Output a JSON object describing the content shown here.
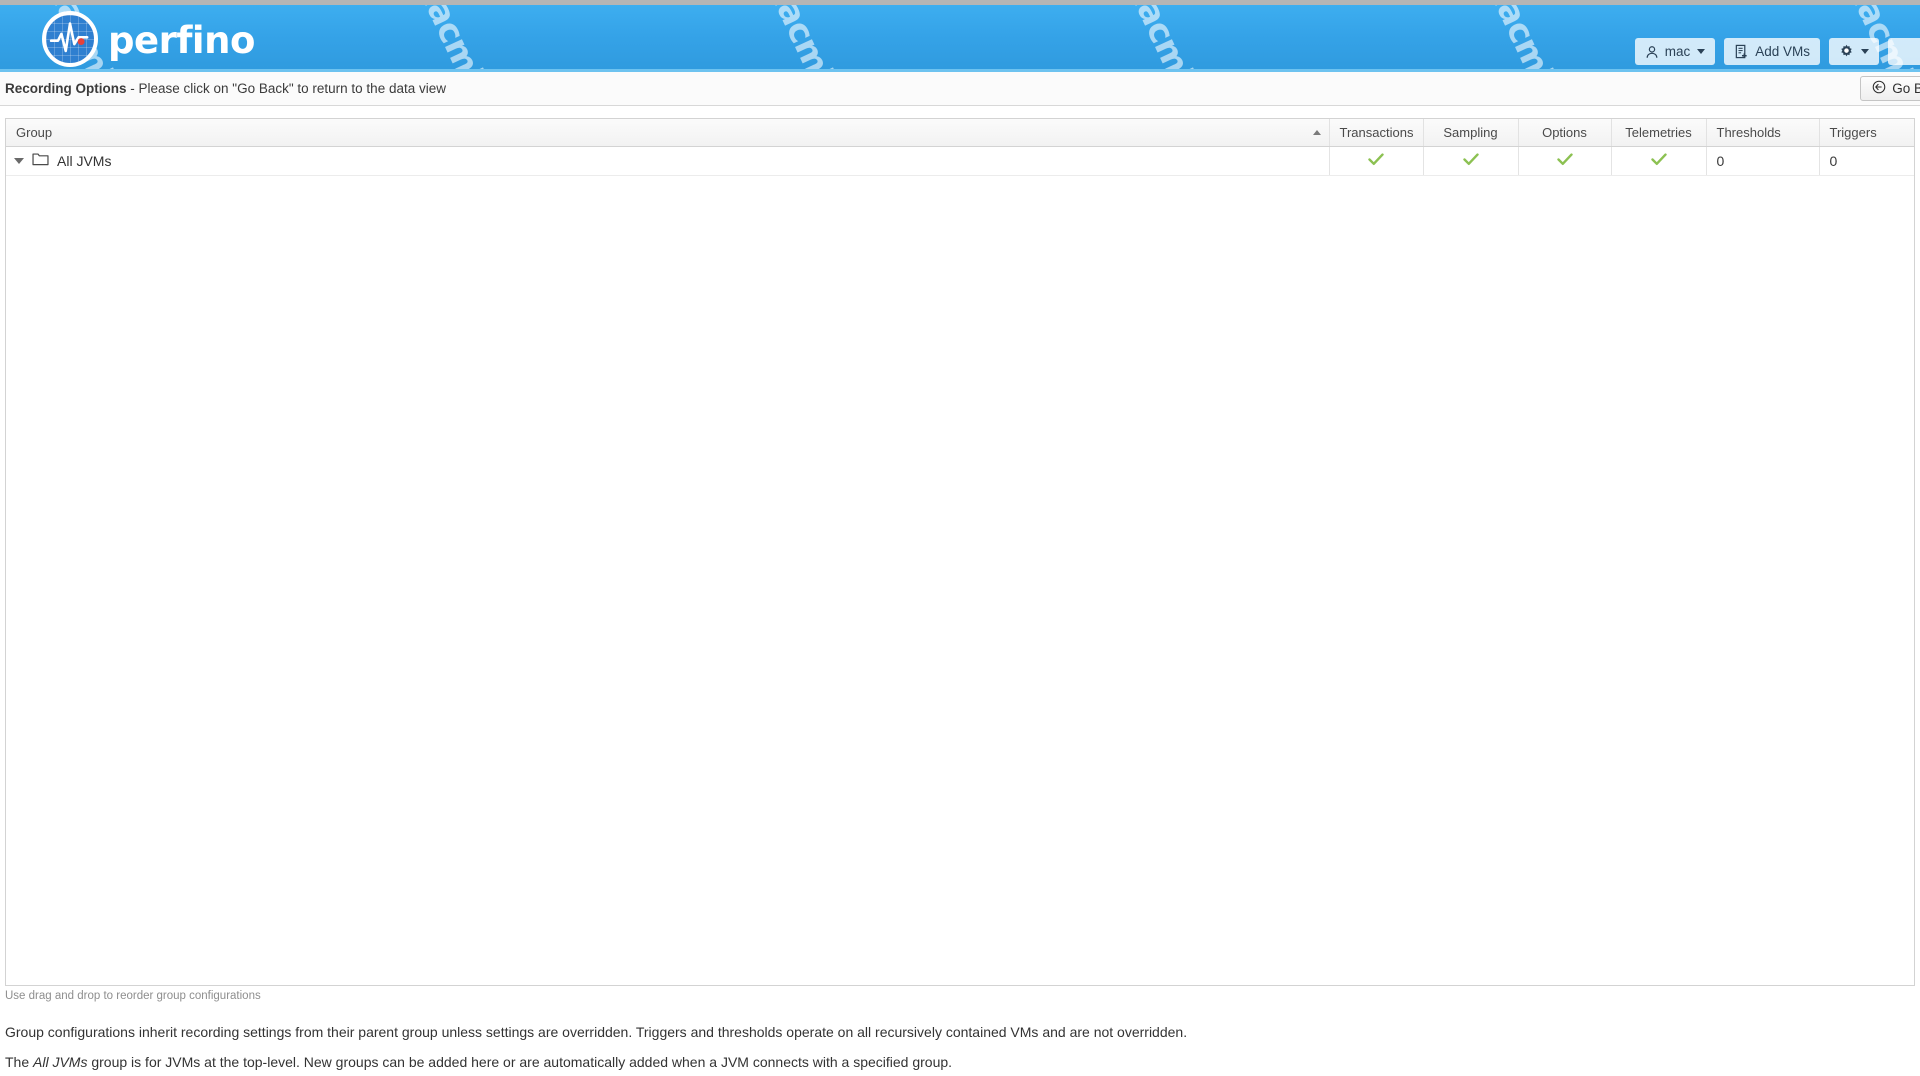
{
  "app": {
    "brand": "perfino",
    "watermark": "macmj.c",
    "accent": "#35a3e8",
    "check_color": "#8cc152"
  },
  "header": {
    "buttons": [
      {
        "id": "user",
        "label": "mac",
        "icon": "user-icon",
        "has_caret": true
      },
      {
        "id": "add-vms",
        "label": "Add VMs",
        "icon": "add-vms-icon",
        "has_caret": false
      },
      {
        "id": "settings",
        "label": "",
        "icon": "gear-icon",
        "has_caret": true
      },
      {
        "id": "more",
        "label": "",
        "icon": "",
        "has_caret": false
      }
    ]
  },
  "subbar": {
    "title": "Recording Options",
    "message": " - Please click on \"Go Back\" to return to the data view",
    "go_back_label": "Go Back",
    "go_back_icon": "back-arrow-icon"
  },
  "table": {
    "columns": [
      {
        "key": "group",
        "label": "Group",
        "align": "left",
        "sorted": "asc"
      },
      {
        "key": "transactions",
        "label": "Transactions",
        "align": "center"
      },
      {
        "key": "sampling",
        "label": "Sampling",
        "align": "center"
      },
      {
        "key": "options",
        "label": "Options",
        "align": "center"
      },
      {
        "key": "telemetries",
        "label": "Telemetries",
        "align": "center"
      },
      {
        "key": "thresholds",
        "label": "Thresholds",
        "align": "left"
      },
      {
        "key": "triggers",
        "label": "Triggers",
        "align": "left"
      }
    ],
    "rows": [
      {
        "group": "All JVMs",
        "expanded": true,
        "icon": "folder-icon",
        "transactions": "check",
        "sampling": "check",
        "options": "check",
        "telemetries": "check",
        "thresholds": "0",
        "triggers": "0"
      }
    ]
  },
  "footer": {
    "hint": "Use drag and drop to reorder group configurations",
    "note1": "Group configurations inherit recording settings from their parent group unless settings are overridden. Triggers and thresholds operate on all recursively contained VMs and are not overridden.",
    "note2_a": "The ",
    "note2_em": "All JVMs",
    "note2_b": " group is for JVMs at the top-level. New groups can be added here or are automatically added when a JVM connects with a specified group."
  }
}
